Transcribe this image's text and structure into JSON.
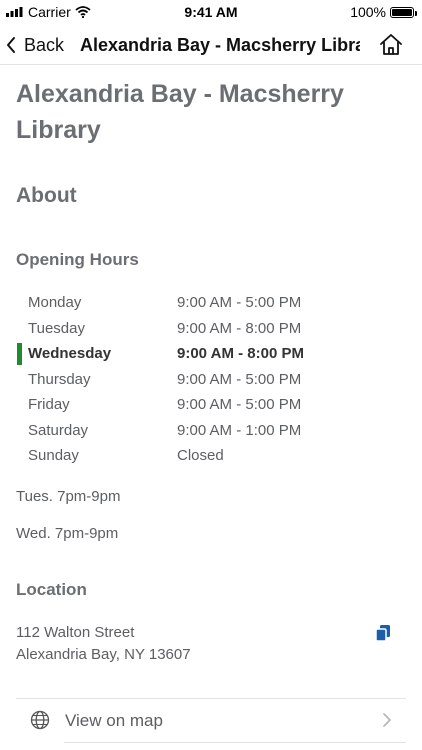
{
  "status_bar": {
    "carrier": "Carrier",
    "time": "9:41 AM",
    "battery": "100%",
    "battery_level": 1.0,
    "icons": [
      "signal-icon",
      "wifi-icon",
      "battery-icon"
    ]
  },
  "nav": {
    "back_label": "Back",
    "title": "Alexandria Bay - Macsherry Library",
    "icons": [
      "chevron-left-icon",
      "home-icon"
    ]
  },
  "page": {
    "title": "Alexandria Bay - Macsherry Library"
  },
  "about": {
    "heading": "About"
  },
  "opening_hours": {
    "heading": "Opening Hours",
    "rows": [
      {
        "day": "Monday",
        "hours": "9:00 AM - 5:00 PM"
      },
      {
        "day": "Tuesday",
        "hours": "9:00 AM - 8:00 PM"
      },
      {
        "day": "Wednesday",
        "hours": "9:00 AM - 8:00 PM"
      },
      {
        "day": "Thursday",
        "hours": "9:00 AM - 5:00 PM"
      },
      {
        "day": "Friday",
        "hours": "9:00 AM - 5:00 PM"
      },
      {
        "day": "Saturday",
        "hours": "9:00 AM - 1:00 PM"
      },
      {
        "day": "Sunday",
        "hours": "Closed"
      }
    ],
    "today": "Wednesday",
    "notes": [
      "Tues. 7pm-9pm",
      "Wed. 7pm-9pm"
    ]
  },
  "location": {
    "heading": "Location",
    "address_line1": "112 Walton Street",
    "address_line2": "Alexandria Bay, NY 13607",
    "view_on_map": "View on map",
    "icons": [
      "copy-icon",
      "globe-icon",
      "chevron-right-icon"
    ]
  },
  "colors": {
    "today_marker": "#1f8a2e",
    "accent_copy": "#1b5fa8",
    "heading_gray": "#6b6e72"
  }
}
